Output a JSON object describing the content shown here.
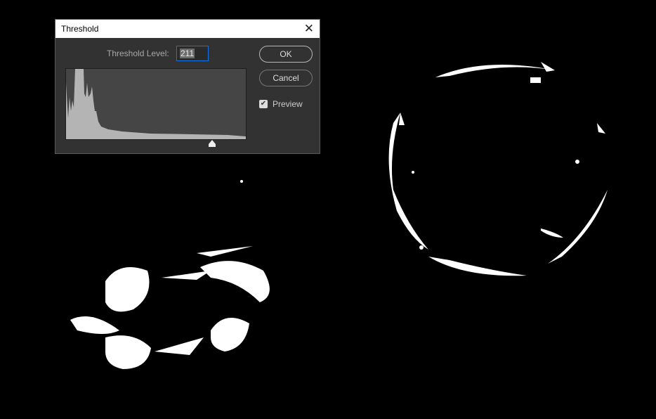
{
  "dialog": {
    "title": "Threshold",
    "close_icon": "close-icon",
    "threshold_level_label": "Threshold Level:",
    "threshold_level_value": "211",
    "ok_label": "OK",
    "cancel_label": "Cancel",
    "preview_label": "Preview",
    "preview_checked": true,
    "slider_value": 211,
    "colors": {
      "accent": "#1473e6",
      "panel": "#323232",
      "histogram": "#b4b4b4"
    }
  }
}
